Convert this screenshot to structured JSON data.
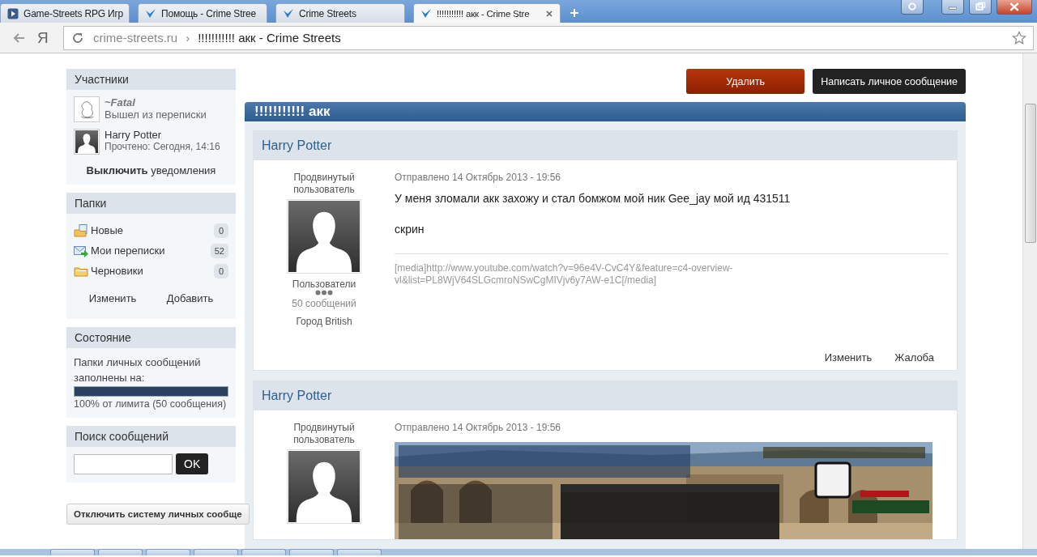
{
  "browser": {
    "tabs": [
      {
        "title": "Game-Streets RPG Игр",
        "selected": false
      },
      {
        "title": "Помощь - Crime Stree",
        "selected": false
      },
      {
        "title": "Crime Streets",
        "selected": false
      },
      {
        "title": "!!!!!!!!!!! акк - Crime Stre",
        "selected": true
      }
    ],
    "home_letter": "Я",
    "address": {
      "domain": "crime-streets.ru",
      "separator": "›",
      "title": "!!!!!!!!!!! акк - Crime Streets"
    }
  },
  "sidebar": {
    "participants": {
      "title": "Участники",
      "members": [
        {
          "name": "~Fatal",
          "status": "Вышел из переписки",
          "left": true
        },
        {
          "name": "Harry Potter",
          "status": "Прочтено: Сегодня, 14:16",
          "left": false
        }
      ],
      "notify_toggle": "**Выключить** уведомления"
    },
    "folders": {
      "title": "Папки",
      "items": [
        {
          "name": "Новые",
          "count": "0",
          "kind": "new"
        },
        {
          "name": "Мои переписки",
          "count": "52",
          "kind": "mail"
        },
        {
          "name": "Черновики",
          "count": "0",
          "kind": "drafts"
        }
      ],
      "actions": [
        "Изменить",
        "Добавить"
      ]
    },
    "storage": {
      "title": "Состояние",
      "text": "Папки личных сообщений заполнены на:",
      "level": 1,
      "caption": "100% от лимита (50 сообщения)"
    },
    "search": {
      "title": "Поиск сообщений",
      "button": "OK"
    },
    "disable_button": "Отключить систему личных сообще"
  },
  "main": {
    "actions": [
      {
        "label": "Удалить",
        "kind": "danger"
      },
      {
        "label": "Написать личное сообщение",
        "kind": "dark"
      }
    ],
    "topic_title": "!!!!!!!!!!! акк",
    "posts": [
      {
        "author": "Harry Potter",
        "rank": "Продвинутый пользователь",
        "group": "Пользователи",
        "post_count": "50 сообщений",
        "city": "Город British",
        "sent": "Отправлено 14 Октябрь 2013 - 19:56",
        "body": [
          "У меня зломали акк захожу и стал бомжом мой ник Gee_jay мой ид 431511",
          "скрин"
        ],
        "signature": "[media]http://www.youtube.com/watch?v=96e4V-CvC4Y&feature=c4-overview-vl&list=PL8WjV64SLGcmroNSwCgMIVjv6y7AW-e1C[/media]",
        "actions": [
          "Изменить",
          "Жалоба"
        ]
      },
      {
        "author": "Harry Potter",
        "rank": "Продвинутый пользователь",
        "sent": "Отправлено 14 Октябрь 2013 - 19:56"
      }
    ]
  }
}
